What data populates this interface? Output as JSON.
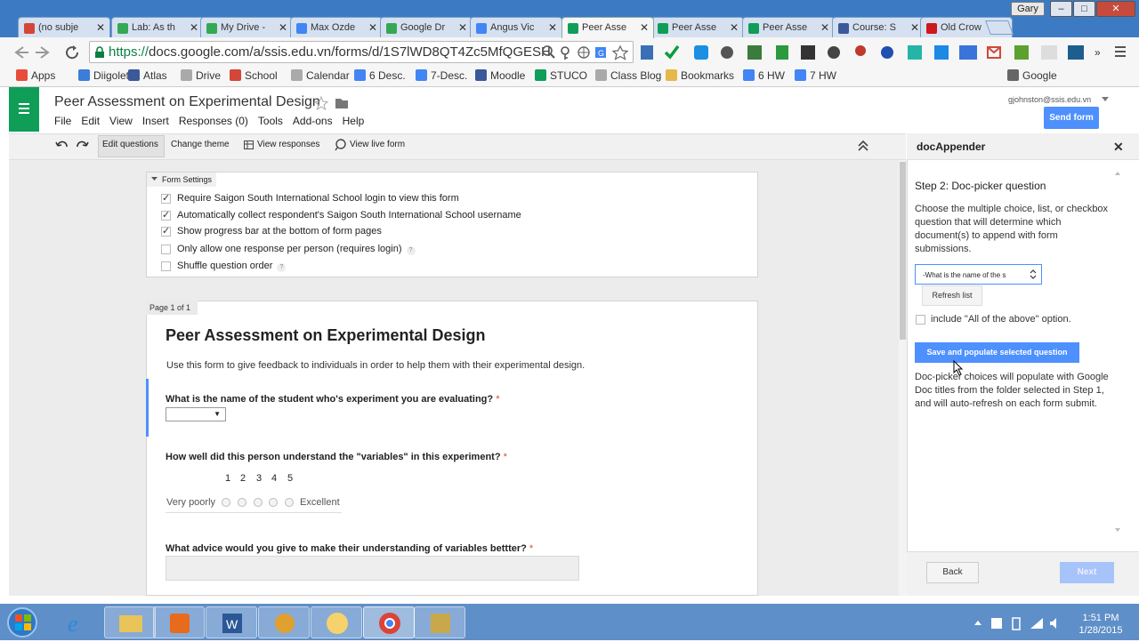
{
  "window": {
    "user_button": "Gary",
    "min": "–",
    "max": "□",
    "close": "✕"
  },
  "tabs": [
    {
      "label": "(no subje",
      "color": "#d44638"
    },
    {
      "label": "Lab: As th",
      "color": "#34a853"
    },
    {
      "label": "My Drive -",
      "color": "#34a853"
    },
    {
      "label": "Max Ozde",
      "color": "#4285f4"
    },
    {
      "label": "Google Dr",
      "color": "#34a853"
    },
    {
      "label": "Angus Vic",
      "color": "#4285f4"
    },
    {
      "label": "Peer Asse",
      "color": "#0f9d58"
    },
    {
      "label": "Peer Asse",
      "color": "#0f9d58"
    },
    {
      "label": "Peer Asse",
      "color": "#0f9d58"
    },
    {
      "label": "Course: S",
      "color": "#3b5998"
    },
    {
      "label": "Old Crow",
      "color": "#cc181e"
    }
  ],
  "tab_close": "✕",
  "address": {
    "protocol": "https://",
    "url": "docs.google.com/a/ssis.edu.vn/forms/d/1S7lWD8QT4Zc5MfQGESH"
  },
  "bookmarks": [
    {
      "label": "Apps",
      "color": "#e74c3c"
    },
    {
      "label": "Diigolet",
      "color": "#3b7dd8"
    },
    {
      "label": "Atlas",
      "color": "#3b5998"
    },
    {
      "label": "Drive",
      "color": "#aaaaaa"
    },
    {
      "label": "School",
      "color": "#d44638"
    },
    {
      "label": "Calendar",
      "color": "#aaaaaa"
    },
    {
      "label": "6 Desc.",
      "color": "#4285f4"
    },
    {
      "label": "7-Desc.",
      "color": "#4285f4"
    },
    {
      "label": "Moodle",
      "color": "#3b5998"
    },
    {
      "label": "STUCO",
      "color": "#0f9d58"
    },
    {
      "label": "Class Blog",
      "color": "#aaaaaa"
    },
    {
      "label": "Bookmarks",
      "color": "#e5b84c"
    },
    {
      "label": "6 HW",
      "color": "#4285f4"
    },
    {
      "label": "7 HW",
      "color": "#4285f4"
    },
    {
      "label": "Google",
      "color": "#666666"
    }
  ],
  "form": {
    "doc_title": "Peer Assessment on Experimental Design",
    "menus": [
      "File",
      "Edit",
      "View",
      "Insert",
      "Responses (0)",
      "Tools",
      "Add-ons",
      "Help"
    ],
    "account_email": "gjohnston@ssis.edu.vn",
    "send_form": "Send form",
    "toolbar": {
      "edit_questions": "Edit questions",
      "change_theme": "Change theme",
      "view_responses": "View responses",
      "view_live_form": "View live form"
    }
  },
  "settings": {
    "header": "Form Settings",
    "items": [
      {
        "label": "Require Saigon South International School login to view this form",
        "checked": true
      },
      {
        "label": "Automatically collect respondent's Saigon South International School username",
        "checked": true
      },
      {
        "label": "Show progress bar at the bottom of form pages",
        "checked": true
      },
      {
        "label": "Only allow one response per person (requires login)",
        "checked": false
      },
      {
        "label": "Shuffle question order",
        "checked": false
      }
    ]
  },
  "page": {
    "label": "Page 1 of 1",
    "title": "Peer Assessment on Experimental Design",
    "description": "Use this form to give feedback to individuals in order to help them with their experimental design.",
    "q1": "What is the name of the student who's experiment you are evaluating?",
    "q2": "How well did this person understand the \"variables\" in this experiment?",
    "scale_numbers": [
      "1",
      "2",
      "3",
      "4",
      "5"
    ],
    "scale_low": "Very poorly",
    "scale_high": "Excellent",
    "q3": "What advice would you give to make their understanding of variables bettter?",
    "required_mark": "*"
  },
  "sidebar": {
    "title": "docAppender",
    "close": "✕",
    "step": "Step 2: Doc-picker question",
    "instructions": "Choose the multiple choice, list, or checkbox question that will determine which document(s) to append with form submissions.",
    "selected_question": "-What is the name of the s",
    "refresh": "Refresh list",
    "include_all": "include \"All of the above\" option.",
    "save_button": "Save and populate selected question",
    "note": "Doc-picker choices will populate with Google Doc titles from the folder selected in Step 1, and will auto-refresh on each form submit.",
    "back": "Back",
    "next": "Next"
  },
  "taskbar": {
    "time": "1:51 PM",
    "date": "1/28/2015"
  }
}
